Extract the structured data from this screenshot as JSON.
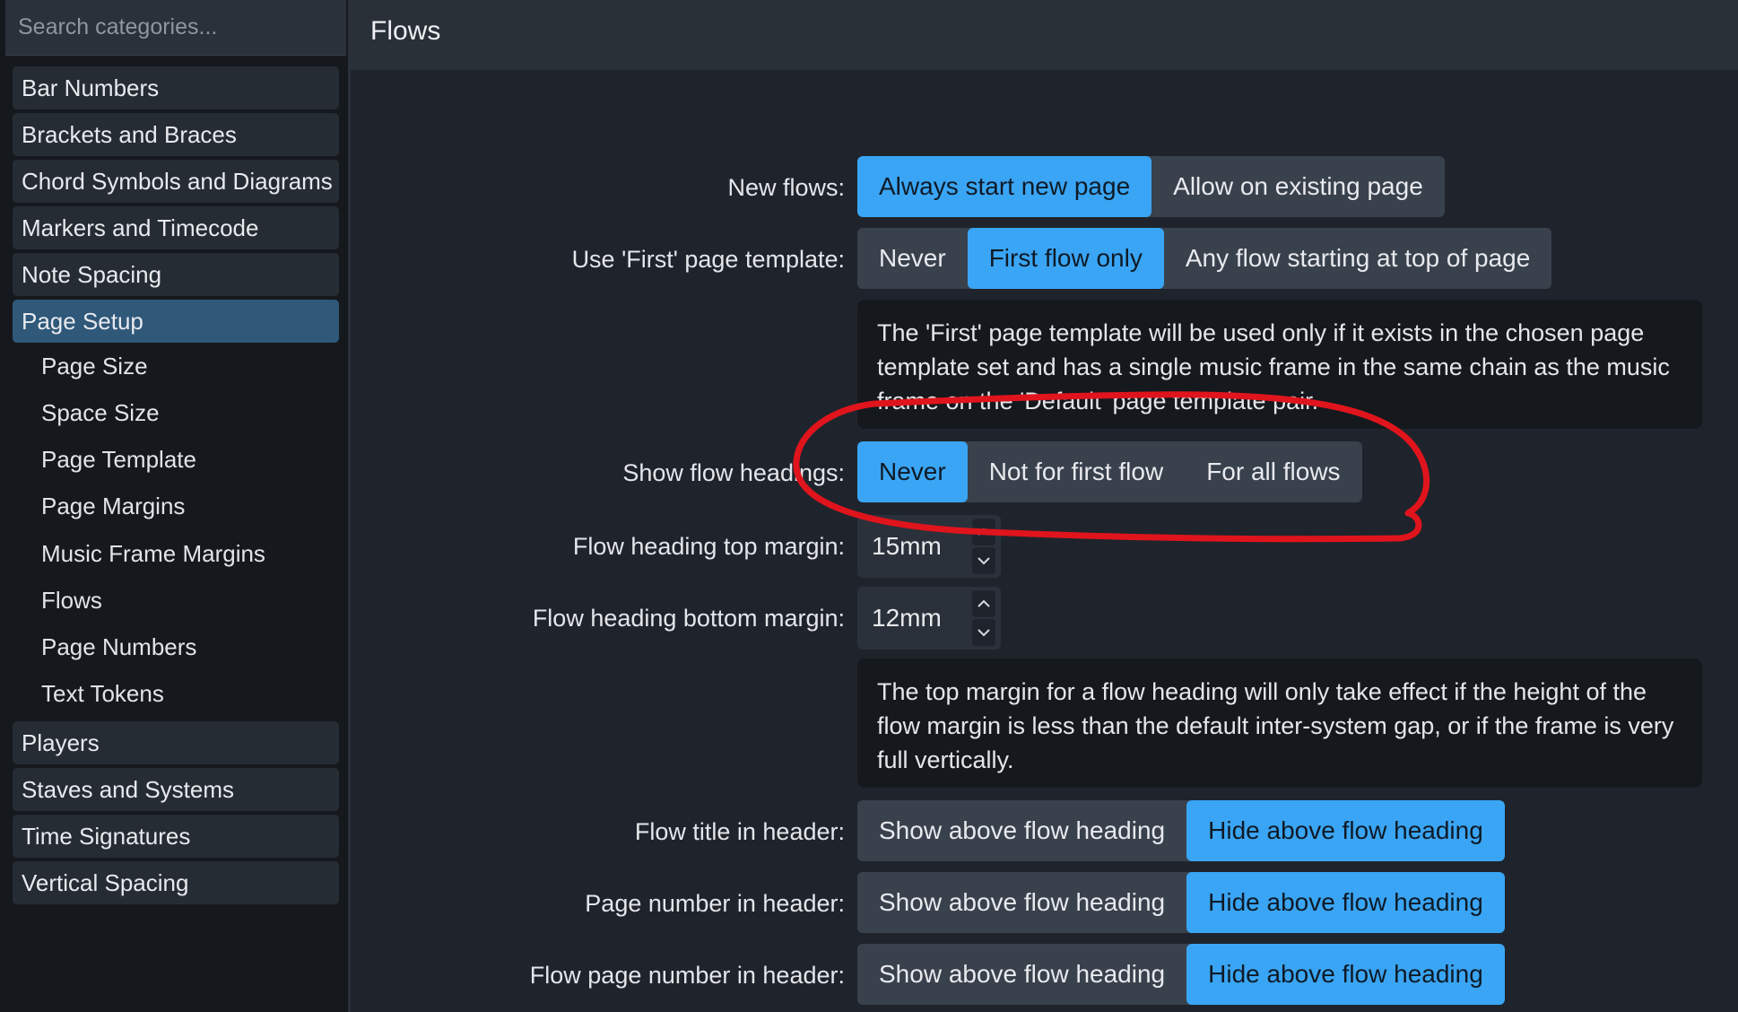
{
  "search": {
    "placeholder": "Search categories..."
  },
  "sidebar": {
    "categories_top": [
      "Bar Numbers",
      "Brackets and Braces",
      "Chord Symbols and Diagrams",
      "Markers and Timecode",
      "Note Spacing"
    ],
    "active": "Page Setup",
    "subitems": [
      "Page Size",
      "Space Size",
      "Page Template",
      "Page Margins",
      "Music Frame Margins",
      "Flows",
      "Page Numbers",
      "Text Tokens"
    ],
    "categories_bottom": [
      "Players",
      "Staves and Systems",
      "Time Signatures",
      "Vertical Spacing"
    ]
  },
  "header": {
    "title": "Flows"
  },
  "settings": {
    "new_flows": {
      "label": "New flows:",
      "options": [
        "Always start new page",
        "Allow on existing page"
      ],
      "selected": 0
    },
    "first_template": {
      "label": "Use 'First' page template:",
      "options": [
        "Never",
        "First flow only",
        "Any flow starting at top of page"
      ],
      "selected": 1
    },
    "first_template_info": "The 'First' page template will be used only if it exists in the chosen page template set and has a single music frame in the same chain as the music frame on the 'Default' page template pair.",
    "show_headings": {
      "label": "Show flow headings:",
      "options": [
        "Never",
        "Not for first flow",
        "For all flows"
      ],
      "selected": 0
    },
    "top_margin": {
      "label": "Flow heading top margin:",
      "value": "15mm"
    },
    "bottom_margin": {
      "label": "Flow heading bottom margin:",
      "value": "12mm"
    },
    "margin_info": "The top margin for a flow heading will only take effect if the height of the flow margin is less than the default inter-system gap, or if the frame is very full vertically.",
    "flow_title": {
      "label": "Flow title in header:",
      "options": [
        "Show above flow heading",
        "Hide above flow heading"
      ],
      "selected": 1
    },
    "page_number": {
      "label": "Page number in header:",
      "options": [
        "Show above flow heading",
        "Hide above flow heading"
      ],
      "selected": 1
    },
    "flow_page_number": {
      "label": "Flow page number in header:",
      "options": [
        "Show above flow heading",
        "Hide above flow heading"
      ],
      "selected": 1
    }
  },
  "colors": {
    "accent": "#3aa5f4",
    "active_category": "#2f5879",
    "annotation": "#e0141c"
  },
  "icons": {
    "spinner_up": "chevron-up-icon",
    "spinner_down": "chevron-down-icon"
  }
}
